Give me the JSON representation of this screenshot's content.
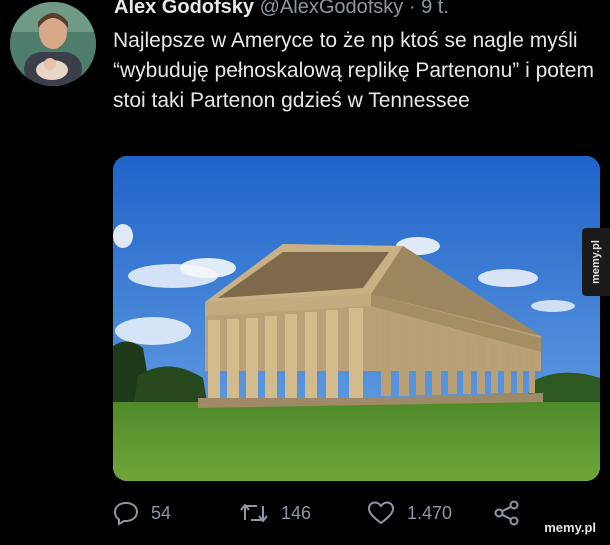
{
  "tweet": {
    "author_name": "Alex Godofsky",
    "author_handle": "@AlexGodofsky",
    "separator": " · ",
    "time": "9 t.",
    "text": "Najlepsze w Ameryce to że np ktoś se nagle myśli “wybuduję pełnoskalową replikę Partenonu” i potem stoi taki Partenon gdzieś w Tennessee"
  },
  "actions": {
    "reply_count": "54",
    "retweet_count": "146",
    "like_count": "1.470"
  },
  "watermarks": {
    "side": "memy.pl",
    "bottom": "memy.pl"
  },
  "icons": {
    "avatar": "avatar-photo",
    "reply": "reply-icon",
    "retweet": "retweet-icon",
    "like": "heart-icon",
    "share": "share-icon"
  }
}
